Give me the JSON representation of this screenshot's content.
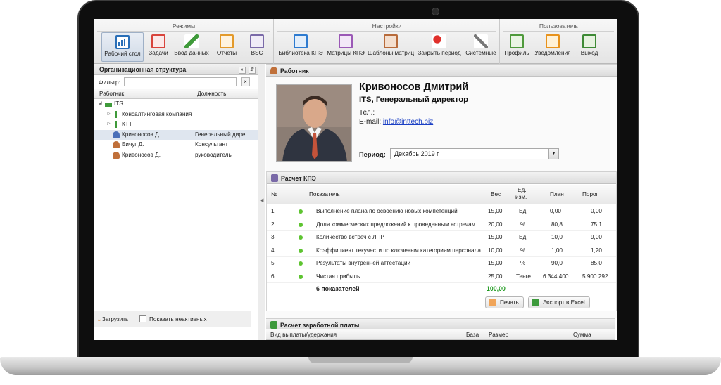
{
  "ribbon": {
    "groups": [
      {
        "title": "Режимы",
        "buttons": [
          "Рабочий стол",
          "Задачи",
          "Ввод данных",
          "Отчеты",
          "BSC"
        ]
      },
      {
        "title": "Настройки",
        "buttons": [
          "Библиотека КПЭ",
          "Матрицы КПЭ",
          "Шаблоны матриц",
          "Закрыть период",
          "Системные"
        ]
      },
      {
        "title": "Пользователь",
        "buttons": [
          "Профиль",
          "Уведомления",
          "Выход"
        ]
      }
    ]
  },
  "left_panel": {
    "title": "Организационная структура",
    "filter_label": "Фильтр:",
    "filter_value": "",
    "filter_clear": "×",
    "collapse_icon": "«",
    "pin_icon": "⇵",
    "col_worker": "Работник",
    "col_position": "Должность",
    "tree": [
      {
        "name": "ITS",
        "position": ""
      },
      {
        "name": "Консалтинговая компания",
        "position": ""
      },
      {
        "name": "КТТ",
        "position": ""
      },
      {
        "name": "Кривоносов Д.",
        "position": "Генеральный дире..."
      },
      {
        "name": "Бичуг Д.",
        "position": "Консультант"
      },
      {
        "name": "Кривоносов Д.",
        "position": "руководитель"
      }
    ],
    "download_label": "Загрузить",
    "show_inactive_label": "Показать неактивных"
  },
  "employee": {
    "section_title": "Работник",
    "name": "Кривоносов Дмитрий",
    "role": "ITS, Генеральный директор",
    "tel_label": "Тел.:",
    "email_label": "E-mail:",
    "email": "info@inttech.biz",
    "period_label": "Период:",
    "period_value": "Декабрь 2019 г."
  },
  "kpi": {
    "section_title": "Расчет КПЭ",
    "headers": {
      "num": "№",
      "indicator": "Показатель",
      "weight": "Вес",
      "unit_1": "Ед.",
      "unit_2": "изм.",
      "plan": "План",
      "threshold": "Порог"
    },
    "rows": [
      {
        "num": "1",
        "indicator": "Выполнение плана по освоению новых компетенций",
        "weight": "15,00",
        "unit": "Ед.",
        "plan": "0,00",
        "threshold": "0,00"
      },
      {
        "num": "2",
        "indicator": "Доля коммерческих предложений к проведенным встречам",
        "weight": "20,00",
        "unit": "%",
        "plan": "80,8",
        "threshold": "75,1"
      },
      {
        "num": "3",
        "indicator": "Количество встреч с ЛПР",
        "weight": "15,00",
        "unit": "Ед.",
        "plan": "10,0",
        "threshold": "9,00"
      },
      {
        "num": "4",
        "indicator": "Коэффициент текучести по ключевым категориям персонала",
        "weight": "10,00",
        "unit": "%",
        "plan": "1,00",
        "threshold": "1,20"
      },
      {
        "num": "5",
        "indicator": "Результаты внутренней аттестации",
        "weight": "15,00",
        "unit": "%",
        "plan": "90,0",
        "threshold": "85,0"
      },
      {
        "num": "6",
        "indicator": "Чистая прибыль",
        "weight": "25,00",
        "unit": "Тенге",
        "plan": "6 344 400",
        "threshold": "5 900 292"
      }
    ],
    "total_label": "6 показателей",
    "total_weight": "100,00",
    "print_label": "Печать",
    "export_label": "Экспорт в Excel"
  },
  "salary": {
    "section_title": "Расчет заработной платы",
    "col_type": "Вид выплаты/удержания",
    "col_base": "База",
    "col_size": "Размер",
    "col_sum": "Сумма"
  },
  "colors": {
    "accent": "#4a7cc4",
    "ok": "#5ec431",
    "total_green": "#1f9a1f",
    "link": "#1a3fc4"
  }
}
